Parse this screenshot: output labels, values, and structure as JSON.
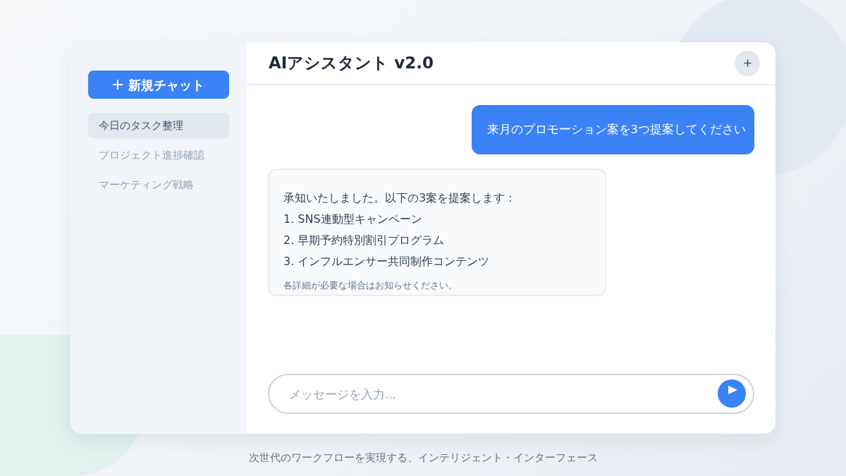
{
  "sidebar": {
    "new_chat_button": "新規チャット",
    "items": [
      {
        "label": "今日のタスク整理",
        "selected": true
      },
      {
        "label": "プロジェクト進捗確認",
        "selected": false
      },
      {
        "label": "マーケティング戦略",
        "selected": false
      }
    ]
  },
  "header": {
    "title": "AIアシスタント v2.0"
  },
  "messages": [
    {
      "kind": "user",
      "lines": [
        "来月のプロモーション案を3つ提案してください"
      ]
    },
    {
      "kind": "assistant",
      "lines": [
        "承知いたしました。以下の3案を提案します：",
        "1. SNS連動型キャンペーン",
        "2. 早期予約特別割引プログラム",
        "3. インフルエンサー共同制作コンテンツ"
      ],
      "note": "各詳細が必要な場合はお知らせください。"
    }
  ],
  "composer": {
    "placeholder": "メッセージを入力..."
  },
  "footer": "次世代のワークフローを実現する、インテリジェント・インターフェース"
}
